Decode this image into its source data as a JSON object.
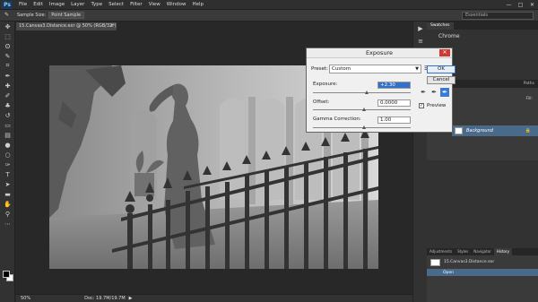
{
  "menubar": {
    "logo": "Ps",
    "items": [
      "File",
      "Edit",
      "Image",
      "Layer",
      "Type",
      "Select",
      "Filter",
      "View",
      "Window",
      "Help"
    ],
    "window_controls": [
      "—",
      "□",
      "✕"
    ]
  },
  "options_bar": {
    "sample_size_label": "Sample Size:",
    "sample_size_value": "Point Sample",
    "show_sampling_ring_label": "Show Sampling Ring",
    "workspace_value": "Essentials"
  },
  "document": {
    "tab_title": "15.Canvas3.Distance.exr @ 50% (RGB/32*)",
    "tab_close": "×",
    "zoom": "50%",
    "doc_info": "Doc: 19.7M/19.7M",
    "status_arrow": "▶"
  },
  "dialog": {
    "title": "Exposure",
    "close": "✕",
    "preset_label": "Preset:",
    "preset_value": "Custom",
    "exposure_label": "Exposure:",
    "exposure_value": "+2.30",
    "offset_label": "Offset:",
    "offset_value": "0.0000",
    "gamma_label": "Gamma Correction:",
    "gamma_value": "1.00",
    "ok_label": "OK",
    "cancel_label": "Cancel",
    "preview_label": "Preview",
    "preview_checked": true,
    "exposure_level": 0.53,
    "offset_level": 0.5,
    "gamma_level": 0.5
  },
  "panels": {
    "top_tabs": [
      "Swatches"
    ],
    "swatch_title": "Chrome",
    "layers_tabs": [
      "Paths"
    ],
    "opacity_label": "Opacity:",
    "fill_label": "Fill:",
    "layer_name": "Background",
    "history_tabs": [
      "Adjustments",
      "Styles",
      "Navigator",
      "History"
    ],
    "snapshot_name": "15.Canvas3.Distance.exr",
    "history_state": "Open"
  }
}
